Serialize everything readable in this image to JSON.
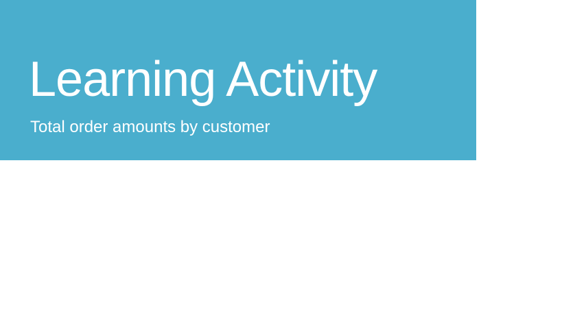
{
  "slide": {
    "title": "Learning Activity",
    "subtitle": "Total order amounts by customer"
  },
  "colors": {
    "banner": "#4aaecd",
    "text": "#ffffff",
    "background": "#ffffff"
  }
}
